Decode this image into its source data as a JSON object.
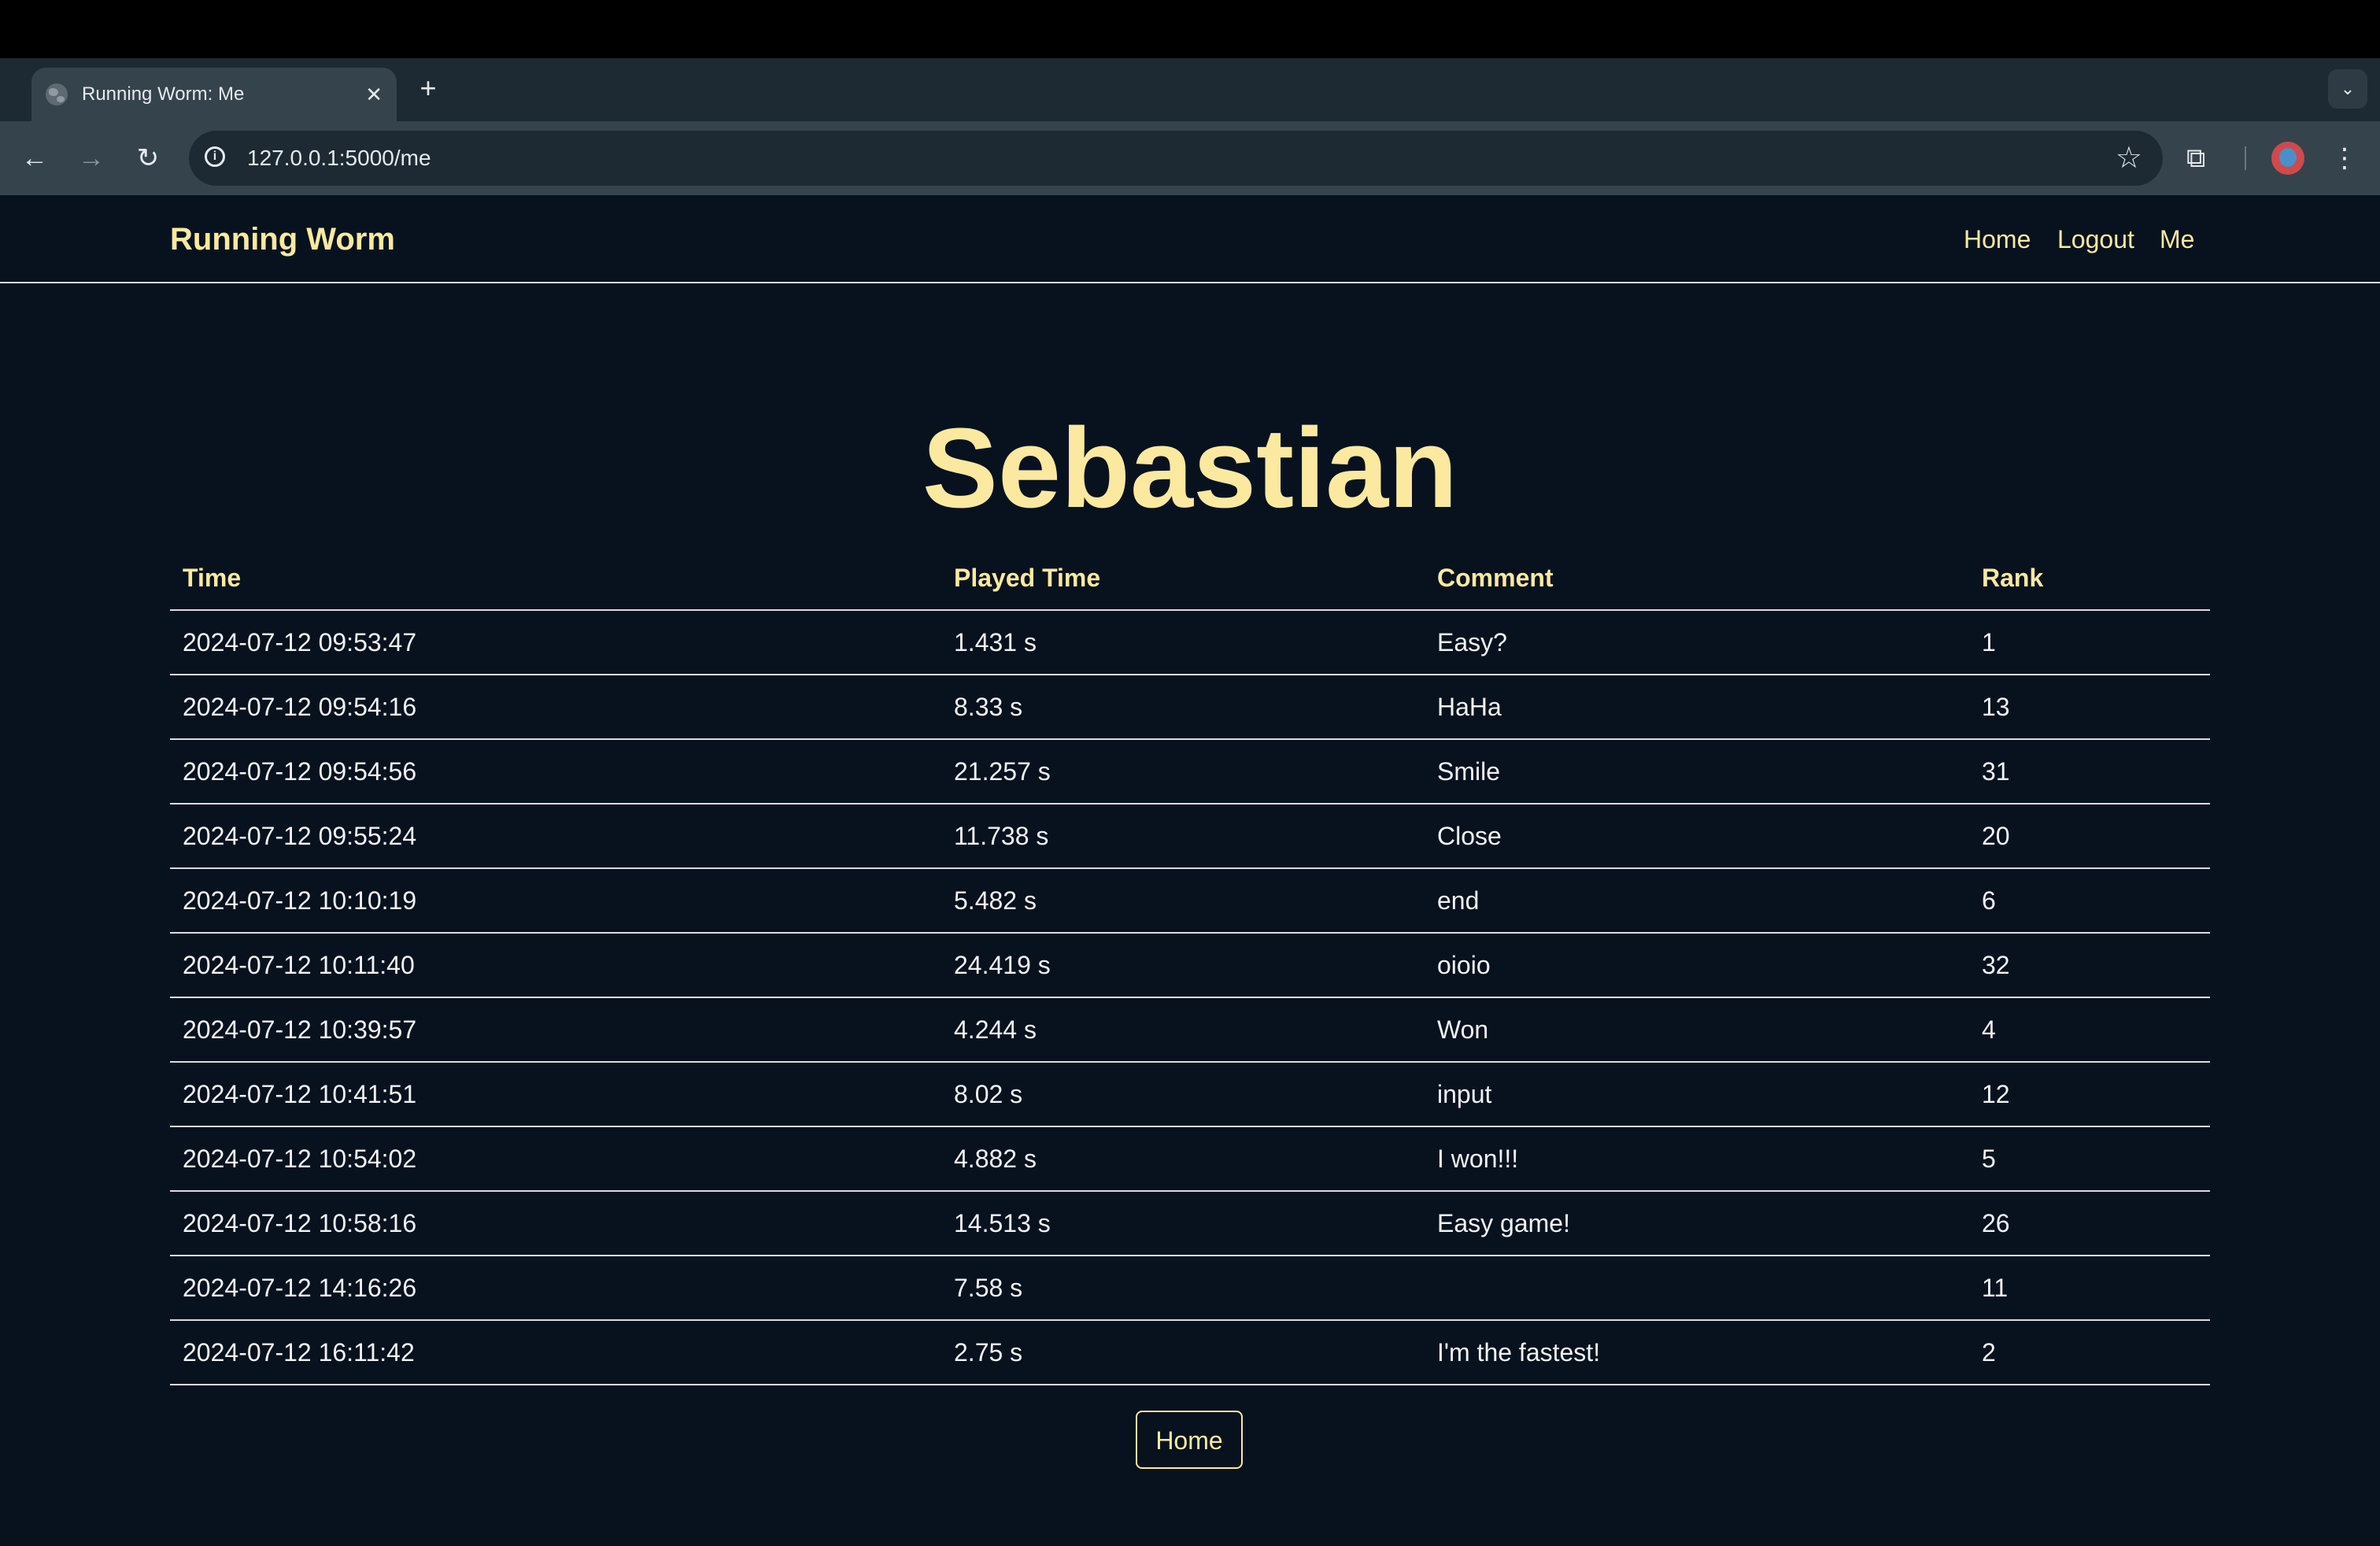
{
  "browser": {
    "tab_title": "Running Worm: Me",
    "tab_close": "✕",
    "new_tab": "+",
    "tab_list": "⌄",
    "back": "←",
    "forward": "→",
    "reload": "↻",
    "info": "i",
    "url": "127.0.0.1:5000/me",
    "bookmark_star": "☆",
    "extensions": "⧉",
    "menu": "⋮",
    "icons": [
      "globe-icon",
      "close-icon",
      "plus-icon",
      "chevron-down-icon",
      "back-arrow-icon",
      "forward-arrow-icon",
      "reload-icon",
      "info-icon",
      "star-icon",
      "puzzle-icon",
      "avatar",
      "kebab-menu-icon"
    ]
  },
  "site": {
    "brand": "Running Worm",
    "nav": [
      "Home",
      "Logout",
      "Me"
    ]
  },
  "main": {
    "heading": "Sebastian",
    "columns": [
      "Time",
      "Played Time",
      "Comment",
      "Rank"
    ],
    "rows": [
      [
        "2024-07-12 09:53:47",
        "1.431 s",
        "Easy?",
        "1"
      ],
      [
        "2024-07-12 09:54:16",
        "8.33 s",
        "HaHa",
        "13"
      ],
      [
        "2024-07-12 09:54:56",
        "21.257 s",
        "Smile",
        "31"
      ],
      [
        "2024-07-12 09:55:24",
        "11.738 s",
        "Close",
        "20"
      ],
      [
        "2024-07-12 10:10:19",
        "5.482 s",
        "end",
        "6"
      ],
      [
        "2024-07-12 10:11:40",
        "24.419 s",
        "oioio",
        "32"
      ],
      [
        "2024-07-12 10:39:57",
        "4.244 s",
        "Won",
        "4"
      ],
      [
        "2024-07-12 10:41:51",
        "8.02 s",
        "input",
        "12"
      ],
      [
        "2024-07-12 10:54:02",
        "4.882 s",
        "I won!!!",
        "5"
      ],
      [
        "2024-07-12 10:58:16",
        "14.513 s",
        "Easy game!",
        "26"
      ],
      [
        "2024-07-12 14:16:26",
        "7.58 s",
        "",
        "11"
      ],
      [
        "2024-07-12 16:11:42",
        "2.75 s",
        "I'm the fastest!",
        "2"
      ]
    ],
    "home_button": "Home"
  },
  "colors": {
    "background": "#08121f",
    "accent": "#fbe9a0",
    "text": "#f2f2f2",
    "rule": "#d8dce0"
  }
}
